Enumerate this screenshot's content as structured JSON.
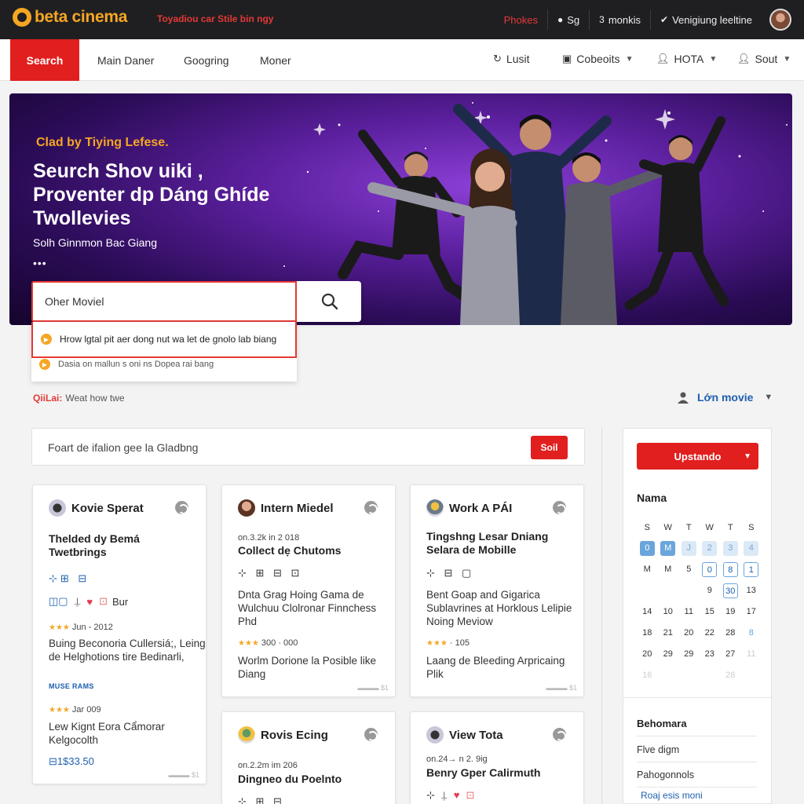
{
  "header": {
    "brand": "beta cinema",
    "tagline": "Toyadiou car Stile bin ngy",
    "right": [
      {
        "label": "Phokes",
        "icon": ""
      },
      {
        "label": "Sg",
        "icon": "dot-icon"
      },
      {
        "label": "monkis",
        "icon": "hash-icon",
        "prefix": "3"
      },
      {
        "label": "Venigiung leeltine",
        "icon": "user-check-icon"
      }
    ]
  },
  "nav": {
    "search": "Search",
    "links": [
      "Main Daner",
      "Googring",
      "Moner"
    ],
    "right": [
      {
        "label": "Lusit",
        "icon": "refresh-icon"
      },
      {
        "label": "Cobeoits",
        "icon": "film-icon"
      },
      {
        "label": "HOTA",
        "icon": "person-icon"
      },
      {
        "label": "Sout",
        "icon": "person-icon"
      }
    ]
  },
  "hero": {
    "kicker": "Clad by Tiying Lefese.",
    "title_lines": [
      "Seurch Shov uiki ,",
      "Proventer dp Dáng Ghíde",
      "Twollevies"
    ],
    "subtitle": "Solh Ginnmon Bac Giang",
    "dots": "•••"
  },
  "search": {
    "value": "Oher Moviel",
    "suggestions": [
      "Hrow lgtal pit aer dong nut wa let de gnolo lab biang",
      "Dasia on mallun s oni ns Dopea rai bang"
    ]
  },
  "hint": {
    "prefix": "QiiLai:",
    "text": "Weat how twe"
  },
  "user_menu": {
    "label": "Lớn movie"
  },
  "filter": {
    "text": "Foart de ifalion gee la Gladbng",
    "button": "Soil"
  },
  "cards": [
    {
      "head": "Kovie Sperat",
      "title": "Thelded dy Bemá Twetbrings",
      "icons1": "⊞⊟",
      "row_icons": "Bur",
      "rating1_meta": "Jun - 2012",
      "text1": "Buing Beconoria Cullersiá;, Leing de Helghotions tire Bedinarli,",
      "tag": "MUSE RAMS",
      "rating2_meta": "Jar 009",
      "text2": "Lew Kignt Eora Cẩmorar Kelgocolth",
      "foot_meta": "⊟1$33.50"
    },
    {
      "head": "Intern Miedel",
      "meta": "on.3.2k in 2 018",
      "title": "Collect dẹ Chutoms",
      "text1": "Dnta Grag Hoing Gama de Wulchuu Clolronar Finnchess Phd",
      "rating_meta": "300 · 000",
      "text2": "Worlm Dorione la Posible like Diang"
    },
    {
      "head": "Work A PÁI",
      "title": "Tingshng Lesar Dniang Selara de Mobille",
      "text1": "Bent Goap and Gigarica Sublavrines at Horklous Lelipie Noing Meviow",
      "rating_meta": "· 105",
      "text2": "Laang de Bleeding Arpricaing Plik"
    },
    {
      "head": "Rovis Ecing",
      "meta": "on.2.2m im 206",
      "title": "Dingneo du Poelnto"
    },
    {
      "head": "View Tota",
      "meta": "on.24→ n 2. 9ig",
      "title": "Benry Gper Calirmuth"
    }
  ],
  "sidebar": {
    "button": "Upstando",
    "cal_title": "Nama",
    "weekdays": [
      "S",
      "W",
      "T",
      "W",
      "T",
      "S"
    ],
    "rows": [
      [
        "0",
        "M",
        "J",
        "2",
        "3",
        "4"
      ],
      [
        "M",
        "M",
        "5",
        "0",
        "8",
        "1"
      ],
      [
        "",
        "",
        "",
        "9",
        "30",
        "13"
      ],
      [
        "14",
        "10",
        "11",
        "15",
        "19",
        "17"
      ],
      [
        "18",
        "21",
        "20",
        "22",
        "28",
        "8"
      ],
      [
        "20",
        "29",
        "29",
        "23",
        "27",
        "11"
      ],
      [
        "16",
        "",
        "",
        "",
        "28",
        ""
      ]
    ],
    "section": "Behomara",
    "items": [
      "Flve digm",
      "Pahogonnols"
    ],
    "link": "Roaj esis moni"
  },
  "colors": {
    "brand": "#f5a623",
    "accent": "#e11f1f",
    "link": "#1e5fae",
    "hero": "#5a1f9c"
  }
}
